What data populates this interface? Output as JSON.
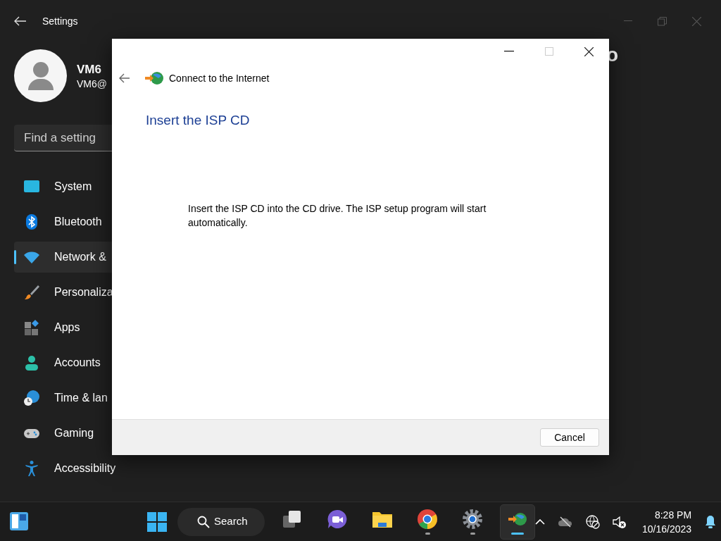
{
  "settings": {
    "title": "Settings",
    "user": {
      "name": "VM6",
      "email": "VM6@"
    },
    "search": {
      "placeholder": "Find a setting"
    },
    "heading_fragment": "o",
    "nav": [
      {
        "kind": "system",
        "label": "System",
        "selected": false
      },
      {
        "kind": "bluetooth",
        "label": "Bluetooth",
        "selected": false
      },
      {
        "kind": "network",
        "label": "Network &",
        "selected": true
      },
      {
        "kind": "personalization",
        "label": "Personaliza",
        "selected": false
      },
      {
        "kind": "apps",
        "label": "Apps",
        "selected": false
      },
      {
        "kind": "accounts",
        "label": "Accounts",
        "selected": false
      },
      {
        "kind": "time",
        "label": "Time & lan",
        "selected": false
      },
      {
        "kind": "gaming",
        "label": "Gaming",
        "selected": false
      },
      {
        "kind": "accessibility",
        "label": "Accessibility",
        "selected": false
      }
    ]
  },
  "dialog": {
    "title": "Connect to the Internet",
    "heading": "Insert the ISP CD",
    "message": "Insert the ISP CD into the CD drive. The ISP setup program will start automatically.",
    "buttons": [
      "Cancel"
    ]
  },
  "taskbar": {
    "search": "Search",
    "time": "8:28 PM",
    "date": "10/16/2023",
    "apps": [
      {
        "kind": "taskview",
        "running": false,
        "active": false
      },
      {
        "kind": "meet",
        "running": false,
        "active": false
      },
      {
        "kind": "folder",
        "running": false,
        "active": false
      },
      {
        "kind": "chrome",
        "running": true,
        "active": false
      },
      {
        "kind": "settings",
        "running": true,
        "active": false
      },
      {
        "kind": "connect",
        "running": true,
        "active": true
      }
    ]
  }
}
